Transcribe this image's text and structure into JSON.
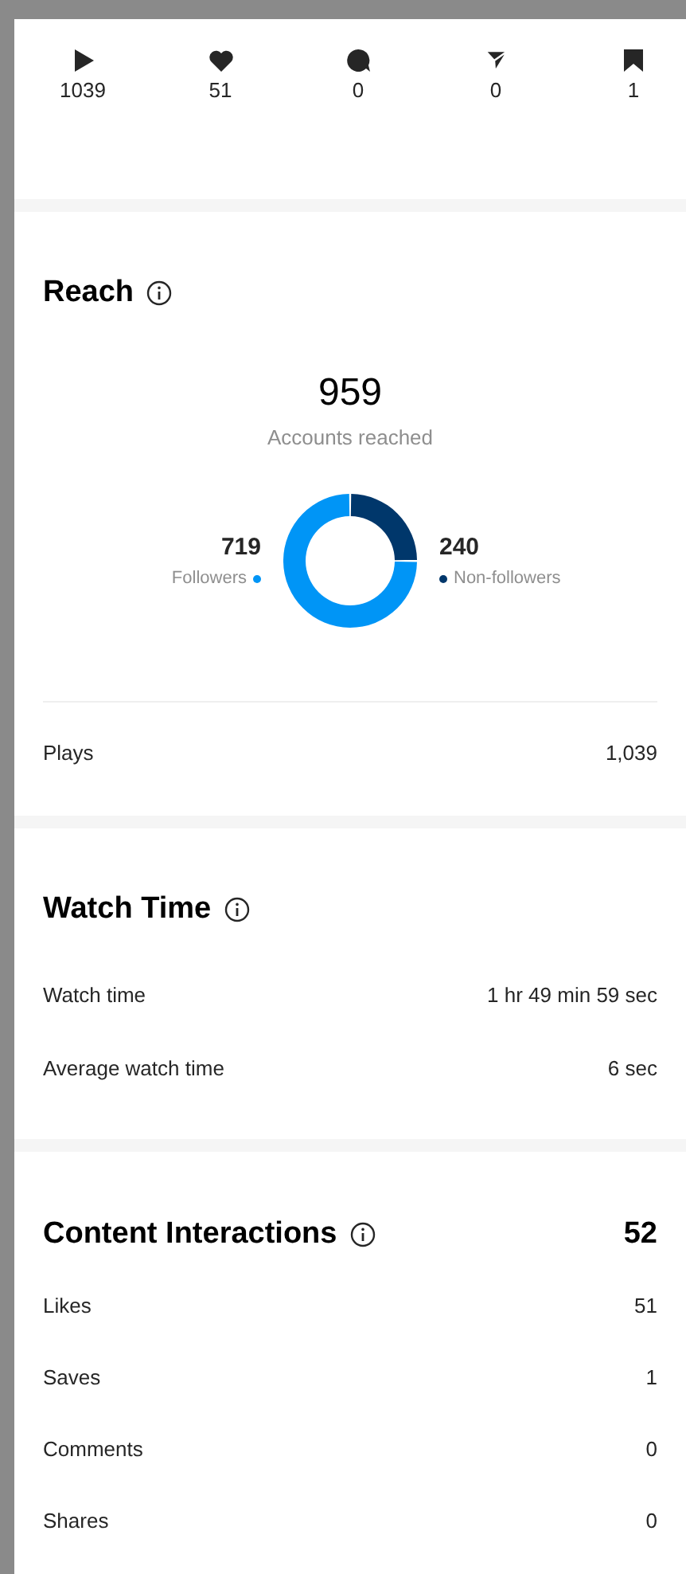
{
  "stats": [
    {
      "kind": "play",
      "value": "1039"
    },
    {
      "kind": "heart",
      "value": "51"
    },
    {
      "kind": "comment",
      "value": "0"
    },
    {
      "kind": "share",
      "value": "0"
    },
    {
      "kind": "save",
      "value": "1"
    }
  ],
  "reach": {
    "title": "Reach",
    "total": "959",
    "total_label": "Accounts reached",
    "chart_data": {
      "type": "donut",
      "categories": [
        "Followers",
        "Non-followers"
      ],
      "values": [
        719,
        240
      ],
      "colors": [
        "#0095f6",
        "#00376b"
      ],
      "data_labels": true
    },
    "rows": [
      {
        "label": "Plays",
        "value": "1,039"
      }
    ]
  },
  "watch_time": {
    "title": "Watch Time",
    "rows": [
      {
        "label": "Watch time",
        "value": "1 hr 49 min 59 sec"
      },
      {
        "label": "Average watch time",
        "value": "6 sec"
      }
    ]
  },
  "content_interactions": {
    "title": "Content Interactions",
    "total": "52",
    "rows": [
      {
        "label": "Likes",
        "value": "51"
      },
      {
        "label": "Saves",
        "value": "1"
      },
      {
        "label": "Comments",
        "value": "0"
      },
      {
        "label": "Shares",
        "value": "0"
      }
    ]
  }
}
